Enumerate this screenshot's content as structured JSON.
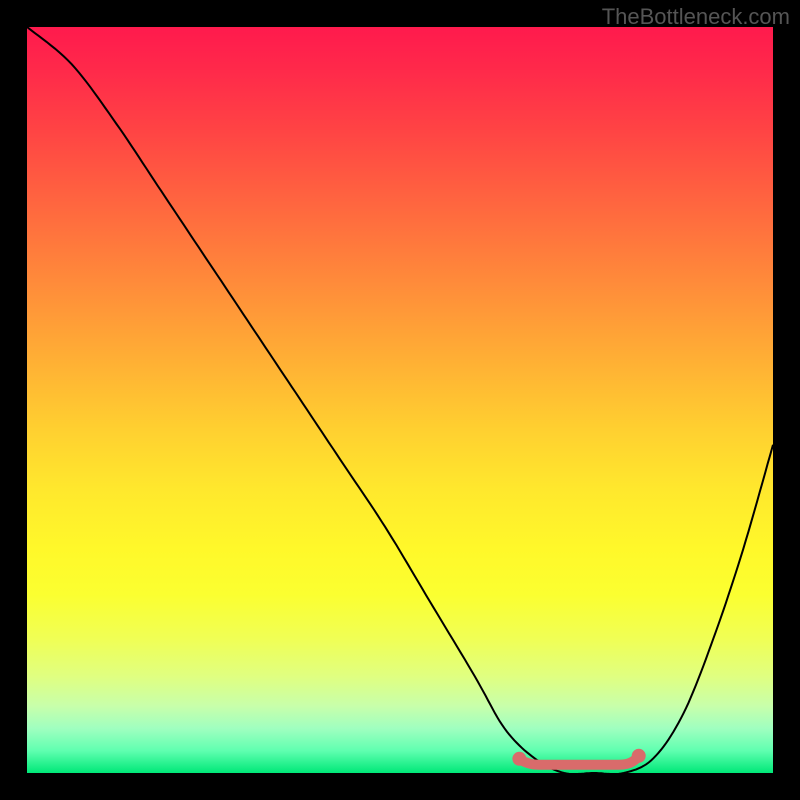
{
  "watermark": "TheBottleneck.com",
  "chart_data": {
    "type": "line",
    "title": "",
    "xlabel": "",
    "ylabel": "",
    "xlim": [
      0,
      100
    ],
    "ylim": [
      0,
      100
    ],
    "grid": false,
    "legend": false,
    "series": [
      {
        "name": "bottleneck-curve",
        "x": [
          0,
          6,
          12,
          18,
          24,
          30,
          36,
          42,
          48,
          54,
          60,
          64,
          68,
          72,
          76,
          80,
          84,
          88,
          92,
          96,
          100
        ],
        "y": [
          100,
          95,
          87,
          78,
          69,
          60,
          51,
          42,
          33,
          23,
          13,
          6,
          2,
          0,
          0,
          0,
          2,
          8,
          18,
          30,
          44
        ],
        "color": "#000000"
      }
    ],
    "marker": {
      "name": "optimal-range",
      "x_start": 66,
      "x_end": 82,
      "y": 1.5,
      "color": "#d96b6b"
    },
    "background_gradient": {
      "top": "#ff1a4d",
      "middle": "#ffe000",
      "bottom": "#00e878"
    }
  }
}
